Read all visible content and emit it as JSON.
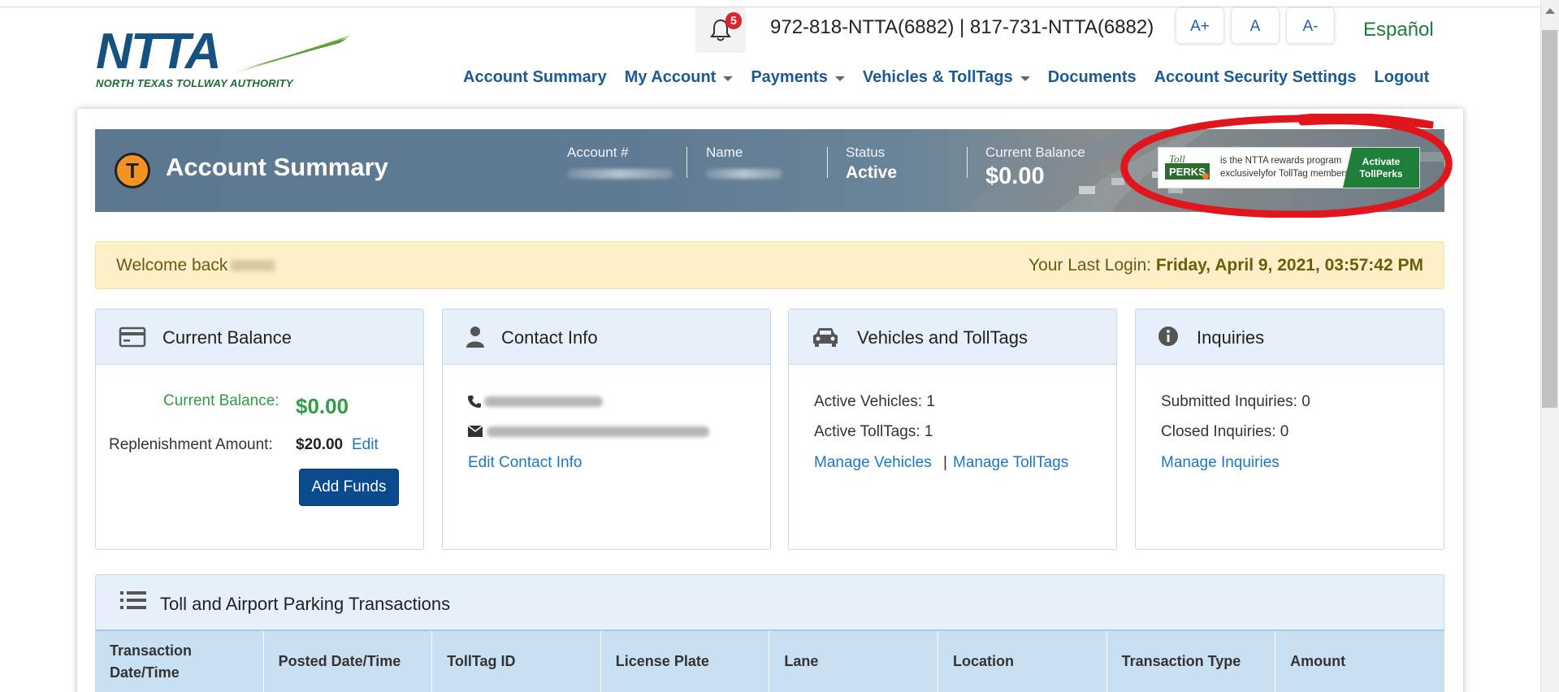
{
  "header": {
    "logo_text": "NTTA",
    "logo_tagline": "NORTH TEXAS TOLLWAY AUTHORITY",
    "notification_count": "5",
    "phones": "972-818-NTTA(6882) | 817-731-NTTA(6882)",
    "font_increase": "A+",
    "font_default": "A",
    "font_decrease": "A-",
    "language": "Español"
  },
  "nav": {
    "account_summary": "Account Summary",
    "my_account": "My Account",
    "payments": "Payments",
    "vehicles_tolltags": "Vehicles & TollTags",
    "documents": "Documents",
    "security": "Account Security Settings",
    "logout": "Logout"
  },
  "banner": {
    "title": "Account Summary",
    "icon_letter": "T",
    "account_label": "Account #",
    "name_label": "Name",
    "status_label": "Status",
    "status_value": "Active",
    "balance_label": "Current Balance",
    "balance_value": "$0.00",
    "perks_text_line1": "is the NTTA rewards program",
    "perks_text_line2": "exclusivelyfor TollTag members",
    "perks_button_line1": "Activate",
    "perks_button_line2": "TollPerks",
    "perks_logo": "PERKS"
  },
  "welcome": {
    "greeting": "Welcome back",
    "last_login_label": "Your Last Login:",
    "last_login_value": "Friday, April 9, 2021, 03:57:42 PM"
  },
  "panels": {
    "balance": {
      "title": "Current Balance",
      "current_label": "Current Balance:",
      "current_value": "$0.00",
      "replenish_label": "Replenishment Amount:",
      "replenish_value": "$20.00",
      "edit_link": "Edit",
      "add_funds": "Add Funds"
    },
    "contact": {
      "title": "Contact Info",
      "edit_link": "Edit Contact Info"
    },
    "vehicles": {
      "title": "Vehicles and TollTags",
      "active_vehicles": "Active Vehicles: 1",
      "active_tolltags": "Active TollTags: 1",
      "manage_vehicles": "Manage Vehicles",
      "separator": "|",
      "manage_tolltags": "Manage TollTags"
    },
    "inquiries": {
      "title": "Inquiries",
      "submitted": "Submitted Inquiries: 0",
      "closed": "Closed Inquiries: 0",
      "manage": "Manage Inquiries"
    }
  },
  "transactions": {
    "title": "Toll and Airport Parking Transactions",
    "columns": [
      "Transaction Date/Time",
      "Posted Date/Time",
      "TollTag ID",
      "License Plate",
      "Lane",
      "Location",
      "Transaction Type",
      "Amount"
    ]
  },
  "colors": {
    "brand_blue": "#1a5a96",
    "link_blue": "#1a78c2",
    "success_green": "#2e9d44",
    "button_navy": "#0b4a8c",
    "alert_yellow": "#fcf0c9",
    "panel_header": "#e5f0fa",
    "badge_red": "#d9262e"
  }
}
